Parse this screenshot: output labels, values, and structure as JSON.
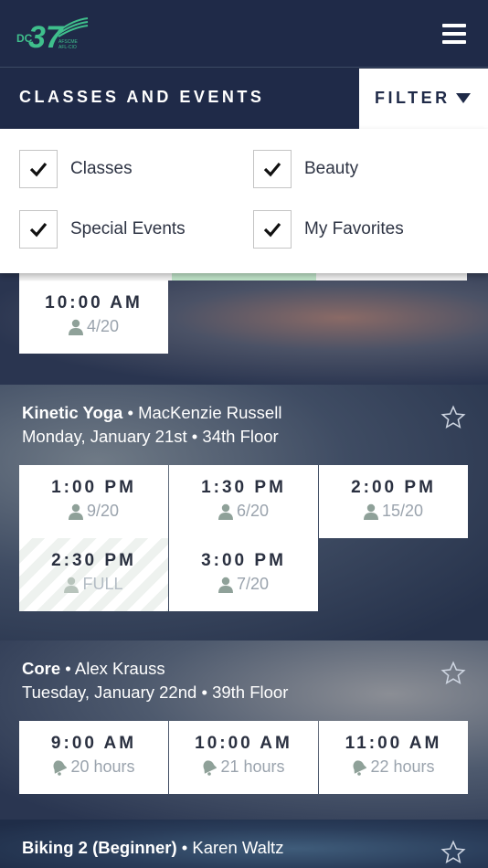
{
  "header": {
    "logo_text": "DC37",
    "logo_sub": "AFSCME AFL-CIO",
    "menu_icon": "hamburger-icon"
  },
  "subbar": {
    "title": "CLASSES AND EVENTS",
    "filter_label": "FILTER"
  },
  "filters": [
    {
      "label": "Classes",
      "checked": true
    },
    {
      "label": "Beauty",
      "checked": true
    },
    {
      "label": "Special Events",
      "checked": true
    },
    {
      "label": "My Favorites",
      "checked": true
    }
  ],
  "sessions": [
    {
      "slots": [
        {
          "time": "10:00 AM",
          "meta": "4/20",
          "icon": "person-icon"
        }
      ]
    },
    {
      "name": "Kinetic Yoga",
      "instructor": "MacKenzie Russell",
      "date": "Monday, January 21st",
      "location": "34th Floor",
      "slots": [
        {
          "time": "1:00 PM",
          "meta": "9/20",
          "icon": "person-icon"
        },
        {
          "time": "1:30 PM",
          "meta": "6/20",
          "icon": "person-icon"
        },
        {
          "time": "2:00 PM",
          "meta": "15/20",
          "icon": "person-icon"
        },
        {
          "time": "2:30 PM",
          "meta": "FULL",
          "icon": "person-icon",
          "full": true
        },
        {
          "time": "3:00 PM",
          "meta": "7/20",
          "icon": "person-icon"
        }
      ]
    },
    {
      "name": "Core",
      "instructor": "Alex Krauss",
      "date": "Tuesday, January 22nd",
      "location": "39th Floor",
      "slots": [
        {
          "time": "9:00 AM",
          "meta": "20 hours",
          "icon": "bell-icon"
        },
        {
          "time": "10:00 AM",
          "meta": "21 hours",
          "icon": "bell-icon"
        },
        {
          "time": "11:00 AM",
          "meta": "22 hours",
          "icon": "bell-icon"
        }
      ]
    },
    {
      "name": "Biking 2 (Beginner)",
      "instructor": "Karen Waltz"
    }
  ],
  "separator": "•",
  "colors": {
    "navy": "#1f2a48",
    "logo_green": "#3fbf8c"
  }
}
